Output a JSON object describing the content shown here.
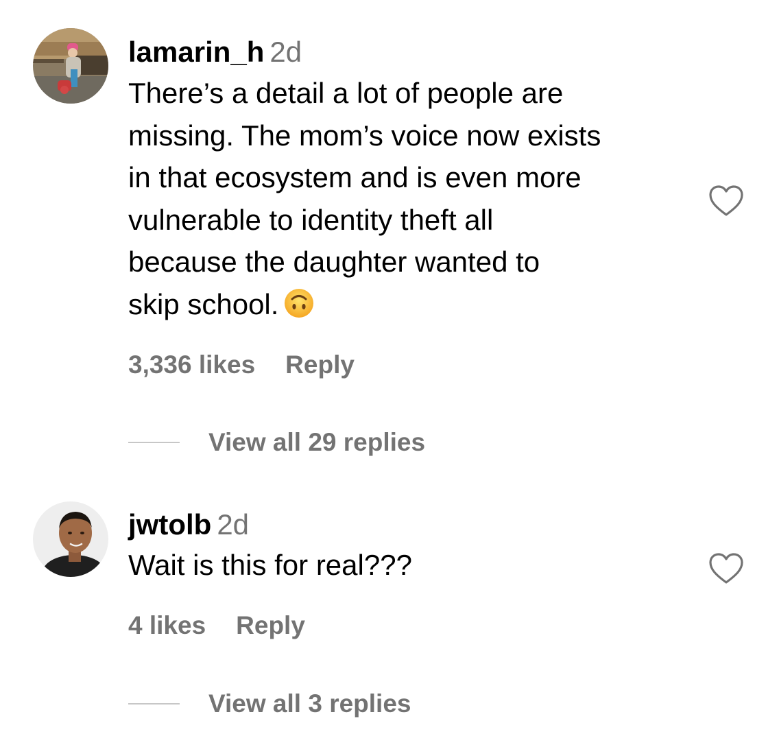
{
  "comments": [
    {
      "username": "lamarin_h",
      "timestamp": "2d",
      "text_lines": [
        "There’s a detail a lot of people are",
        "missing. The mom’s voice now exists",
        "in that ecosystem and is even more",
        "vulnerable to identity theft all",
        "because the daughter wanted to",
        "skip school."
      ],
      "emoji": "upside-down-face-emoji",
      "likes": "3,336 likes",
      "reply_label": "Reply",
      "view_replies": "View all 29 replies",
      "liked": false
    },
    {
      "username": "jwtolb",
      "timestamp": "2d",
      "text_lines": [
        "Wait is this for real???"
      ],
      "likes": "4 likes",
      "reply_label": "Reply",
      "view_replies": "View all 3 replies",
      "liked": false
    }
  ],
  "colors": {
    "text": "#000000",
    "secondary": "#737373",
    "divider": "#c7c7c7",
    "heart_outline": "#737373"
  },
  "icons": {
    "like": "heart-outline-icon"
  }
}
